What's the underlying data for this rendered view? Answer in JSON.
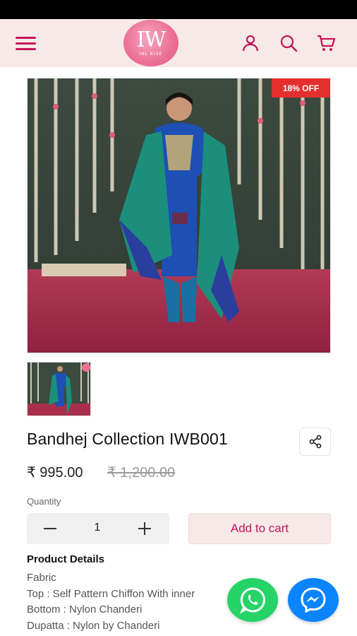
{
  "header": {
    "logo_mark": "IW",
    "logo_sub": "IAL KISE",
    "icons": [
      "menu-icon",
      "user-icon",
      "search-icon",
      "cart-icon"
    ]
  },
  "product": {
    "discount_badge": "18% OFF",
    "title": "Bandhej Collection IWB001",
    "price": "₹ 995.00",
    "old_price": "₹ 1,200.00"
  },
  "quantity": {
    "label": "Quantity",
    "value": "1"
  },
  "actions": {
    "add_to_cart": "Add to cart"
  },
  "details": {
    "title": "Product Details",
    "lines": [
      "Fabric",
      "Top : Self Pattern Chiffon With inner",
      "Bottom : Nylon Chanderi",
      "Dupatta : Nylon by Chanderi"
    ]
  },
  "floating": {
    "whatsapp": "whatsapp-icon",
    "messenger": "messenger-icon"
  },
  "colors": {
    "brand": "#c2185b",
    "header_bg": "#f7e9e7",
    "badge": "#e52f2f",
    "whatsapp": "#25d366",
    "messenger": "#0a84ff"
  }
}
